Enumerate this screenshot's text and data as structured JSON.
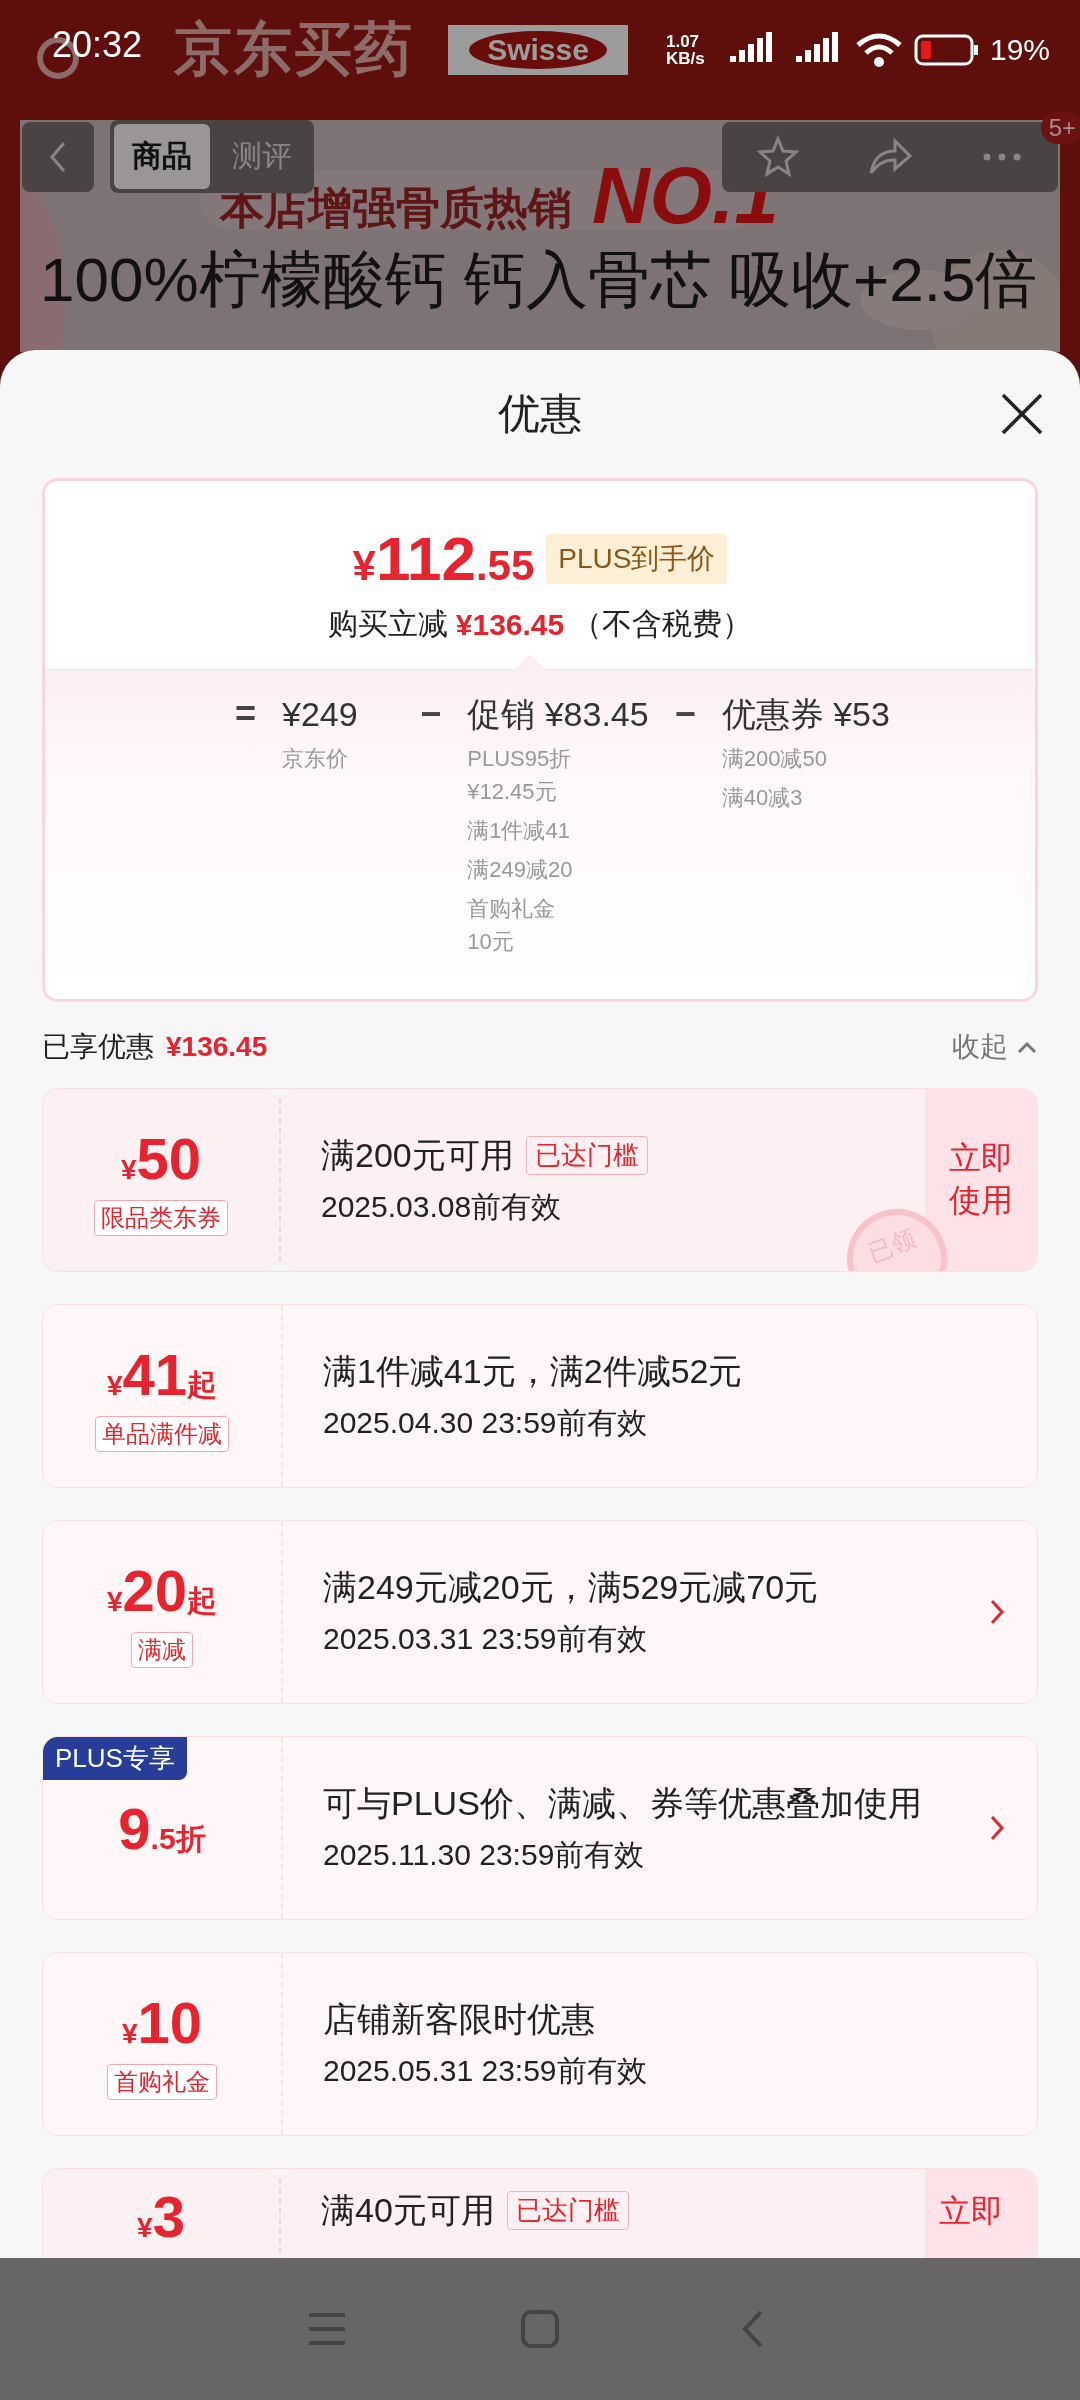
{
  "status_bar": {
    "time": "20:32",
    "net_speed": "1.07 KB/s",
    "battery": "19%"
  },
  "header": {
    "logo": "京东买药",
    "brand": "Swisse"
  },
  "product_nav": {
    "tabs": [
      {
        "label": "商品",
        "selected": true
      },
      {
        "label": "测评",
        "selected": false
      }
    ],
    "more_badge": "5+"
  },
  "banner": {
    "headline": "本店增强骨质热销",
    "rank": "NO.1",
    "tagline": "100%柠檬酸钙 钙入骨芯 吸收+2.5倍"
  },
  "sheet": {
    "title": "优惠",
    "summary": {
      "currency": "¥",
      "price_int": "112",
      "price_dec": ".55",
      "price_tag": "PLUS到手价",
      "saving_label": "购买立减",
      "saving": "¥136.45",
      "saving_note": "（不含税费）",
      "formula": [
        {
          "op": "=",
          "amount": "¥249",
          "items": [
            "京东价"
          ]
        },
        {
          "op": "−",
          "amount": "促销 ¥83.45",
          "items": [
            "PLUS95折¥12.45元",
            "满1件减41",
            "满249减20",
            "首购礼金10元"
          ]
        },
        {
          "op": "−",
          "amount": "优惠券 ¥53",
          "items": [
            "满200减50",
            "满40减3"
          ]
        }
      ]
    },
    "enjoyed": {
      "label": "已享优惠",
      "amount": "¥136.45",
      "toggle": "收起"
    },
    "coupons": [
      {
        "kind": "ticket",
        "currency": "¥",
        "amount": "50",
        "label": "限品类东券",
        "title": "满200元可用",
        "tag": "已达门槛",
        "validity": "2025.03.08前有效",
        "action": "立即使用",
        "stamp": "已领"
      },
      {
        "kind": "promo",
        "currency": "¥",
        "amount": "41",
        "suffix": "起",
        "label": "单品满件减",
        "title": "满1件减41元，满2件减52元",
        "validity": "2025.04.30 23:59前有效",
        "arrow": false
      },
      {
        "kind": "promo",
        "currency": "¥",
        "amount": "20",
        "suffix": "起",
        "label": "满减",
        "title": "满249元减20元，满529元减70元",
        "validity": "2025.03.31 23:59前有效",
        "arrow": true
      },
      {
        "kind": "promo",
        "badge": "PLUS专享",
        "amount": "9",
        "suffix": ".5折",
        "title": "可与PLUS价、满减、券等优惠叠加使用",
        "validity": "2025.11.30 23:59前有效",
        "arrow": true
      },
      {
        "kind": "promo",
        "currency": "¥",
        "amount": "10",
        "label": "首购礼金",
        "title": "店铺新客限时优惠",
        "validity": "2025.05.31 23:59前有效",
        "arrow": false
      },
      {
        "kind": "ticket",
        "currency": "¥",
        "amount": "3",
        "title": "满40元可用",
        "tag": "已达门槛",
        "action": "立即"
      }
    ]
  }
}
